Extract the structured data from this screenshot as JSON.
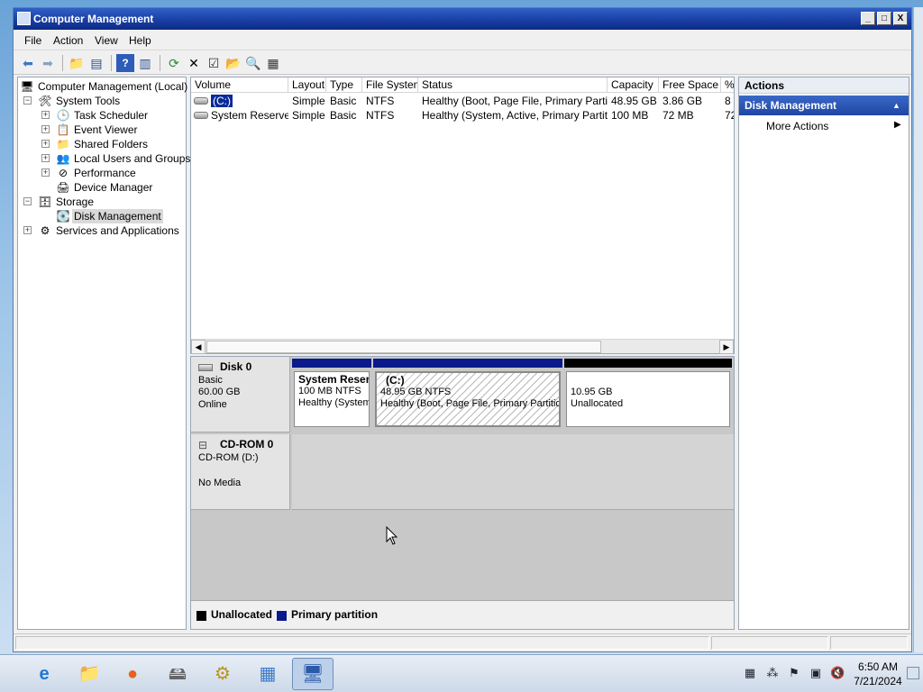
{
  "window": {
    "title": "Computer Management",
    "minimize": "_",
    "maximize": "□",
    "close": "X"
  },
  "menu": [
    "File",
    "Action",
    "View",
    "Help"
  ],
  "tree": {
    "root": "Computer Management (Local)",
    "system_tools": "System Tools",
    "task_scheduler": "Task Scheduler",
    "event_viewer": "Event Viewer",
    "shared_folders": "Shared Folders",
    "local_users": "Local Users and Groups",
    "performance": "Performance",
    "device_manager": "Device Manager",
    "storage": "Storage",
    "disk_management": "Disk Management",
    "services": "Services and Applications",
    "expand": "+",
    "collapse": "−"
  },
  "volume_list": {
    "columns": [
      "Volume",
      "Layout",
      "Type",
      "File System",
      "Status",
      "Capacity",
      "Free Space",
      "%"
    ],
    "rows": [
      [
        "(C:)",
        "Simple",
        "Basic",
        "NTFS",
        "Healthy (Boot, Page File, Primary Partition)",
        "48.95 GB",
        "3.86 GB",
        "8"
      ],
      [
        "System Reserved",
        "Simple",
        "Basic",
        "NTFS",
        "Healthy (System, Active, Primary Partition)",
        "100 MB",
        "72 MB",
        "72"
      ]
    ]
  },
  "disk0": {
    "name": "Disk 0",
    "type": "Basic",
    "size": "60.00 GB",
    "state": "Online",
    "partitions": [
      {
        "name": "System Reser",
        "size": "100 MB NTFS",
        "status": "Healthy (System"
      },
      {
        "name": "(C:)",
        "size": "48.95 GB NTFS",
        "status": "Healthy (Boot, Page File, Primary Partition)"
      },
      {
        "name": "",
        "size": "10.95 GB",
        "status": "Unallocated"
      }
    ]
  },
  "cdrom0": {
    "name": "CD-ROM 0",
    "device": "CD-ROM (D:)",
    "state": "No Media"
  },
  "legend": {
    "unallocated": "Unallocated",
    "primary": "Primary partition"
  },
  "actions": {
    "title": "Actions",
    "section": "Disk Management",
    "more": "More Actions"
  },
  "taskbar": {
    "time": "6:50 AM",
    "date": "7/21/2024"
  },
  "colors": {
    "primary_partition": "#0a1a8a",
    "unallocated": "#000000",
    "title_bar": "#1a3fa3"
  }
}
